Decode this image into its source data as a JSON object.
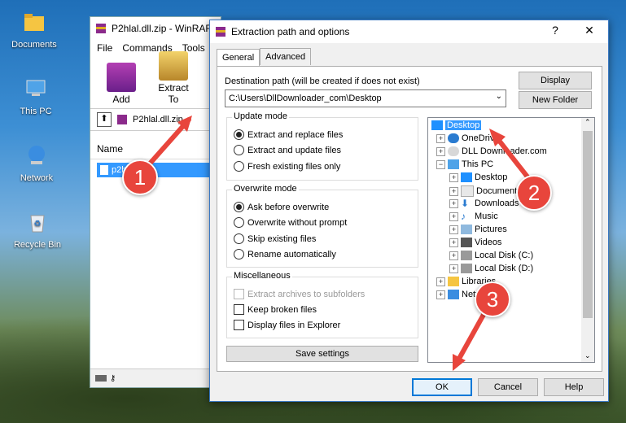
{
  "desktop": {
    "icons": [
      {
        "label": "Documents",
        "icon": "folder-icon"
      },
      {
        "label": "This PC",
        "icon": "computer-icon"
      },
      {
        "label": "Network",
        "icon": "network-icon"
      },
      {
        "label": "Recycle Bin",
        "icon": "recycle-bin-icon"
      }
    ]
  },
  "winrar": {
    "title": "P2hlal.dll.zip - WinRAR",
    "menu": [
      "File",
      "Commands",
      "Tools"
    ],
    "toolbar": [
      {
        "label": "Add"
      },
      {
        "label": "Extract To"
      }
    ],
    "address": "P2hlal.dll.zip",
    "column_name": "Name",
    "file_name": "p2hlal.dll"
  },
  "dialog": {
    "title": "Extraction path and options",
    "help": "?",
    "close": "✕",
    "tabs": [
      "General",
      "Advanced"
    ],
    "dest_label": "Destination path (will be created if does not exist)",
    "dest_value": "C:\\Users\\DllDownloader_com\\Desktop",
    "display_button": "Display",
    "new_folder_button": "New Folder",
    "update_mode": {
      "title": "Update mode",
      "options": [
        "Extract and replace files",
        "Extract and update files",
        "Fresh existing files only"
      ],
      "selected": 0
    },
    "overwrite_mode": {
      "title": "Overwrite mode",
      "options": [
        "Ask before overwrite",
        "Overwrite without prompt",
        "Skip existing files",
        "Rename automatically"
      ],
      "selected": 0
    },
    "misc": {
      "title": "Miscellaneous",
      "options": [
        "Extract archives to subfolders",
        "Keep broken files",
        "Display files in Explorer"
      ]
    },
    "save_settings": "Save settings",
    "tree": [
      {
        "label": "Desktop",
        "selected": true
      },
      {
        "label": "OneDrive"
      },
      {
        "label": "DLL Downloader.com"
      },
      {
        "label": "This PC"
      },
      {
        "label": "Desktop"
      },
      {
        "label": "Documents"
      },
      {
        "label": "Downloads"
      },
      {
        "label": "Music"
      },
      {
        "label": "Pictures"
      },
      {
        "label": "Videos"
      },
      {
        "label": "Local Disk (C:)"
      },
      {
        "label": "Local Disk (D:)"
      },
      {
        "label": "Libraries"
      },
      {
        "label": "Network"
      }
    ],
    "ok": "OK",
    "cancel": "Cancel",
    "help_button": "Help"
  },
  "annotations": [
    "1",
    "2",
    "3"
  ],
  "colors": {
    "accent": "#0078d7",
    "selection": "#3399ff",
    "marker": "#e8453c"
  }
}
